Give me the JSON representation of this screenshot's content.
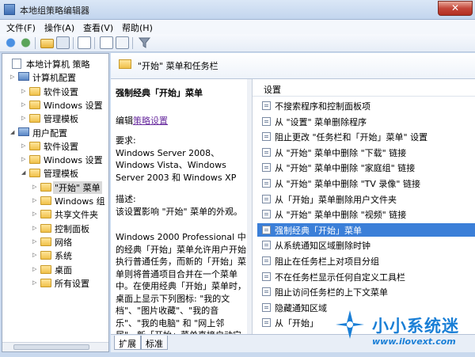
{
  "window": {
    "title": "本地组策略编辑器",
    "close_glyph": "✕"
  },
  "menubar": {
    "items": [
      "文件(F)",
      "操作(A)",
      "查看(V)",
      "帮助(H)"
    ]
  },
  "tree": {
    "nodes": [
      {
        "label": "本地计算机 策略",
        "level": 0,
        "icon": "doc"
      },
      {
        "label": "计算机配置",
        "level": 1,
        "icon": "monitor",
        "expanded": false
      },
      {
        "label": "软件设置",
        "level": 2,
        "icon": "folder"
      },
      {
        "label": "Windows 设置",
        "level": 2,
        "icon": "folder"
      },
      {
        "label": "管理模板",
        "level": 2,
        "icon": "folder"
      },
      {
        "label": "用户配置",
        "level": 1,
        "icon": "monitor",
        "expanded": true
      },
      {
        "label": "软件设置",
        "level": 2,
        "icon": "folder"
      },
      {
        "label": "Windows 设置",
        "level": 2,
        "icon": "folder"
      },
      {
        "label": "管理模板",
        "level": 2,
        "icon": "folder",
        "expanded": true
      },
      {
        "label": "\"开始\" 菜单",
        "level": 3,
        "icon": "folder",
        "selected": true
      },
      {
        "label": "Windows 组",
        "level": 3,
        "icon": "folder"
      },
      {
        "label": "共享文件夹",
        "level": 3,
        "icon": "folder"
      },
      {
        "label": "控制面板",
        "level": 3,
        "icon": "folder"
      },
      {
        "label": "网络",
        "level": 3,
        "icon": "folder"
      },
      {
        "label": "系统",
        "level": 3,
        "icon": "folder"
      },
      {
        "label": "桌面",
        "level": 3,
        "icon": "folder"
      },
      {
        "label": "所有设置",
        "level": 3,
        "icon": "folder"
      }
    ]
  },
  "right_header": {
    "title": "\"开始\" 菜单和任务栏"
  },
  "description": {
    "heading": "强制经典「开始」菜单",
    "edit_prefix": "编辑",
    "edit_link": "策略设置",
    "req_label": "要求:",
    "req_lines": [
      "Windows Server 2008、",
      "Windows Vista、Windows",
      "Server 2003 和 Windows XP"
    ],
    "desc_label": "描述:",
    "desc_lines": [
      "该设置影响 \"开始\" 菜单的外观。"
    ],
    "body_lines": [
      "Windows 2000 Professional 中",
      "的经典「开始」菜单允许用户开始",
      "执行普通任务，而新的「开始」菜",
      "单则将普通项目合并在一个菜单",
      "中。在使用经典「开始」菜单时，",
      "桌面上显示下列图标: \"我的文",
      "档\"、\"图片收藏\"、\"我的音",
      "乐\"、\"我的电脑\" 和 \"网上邻",
      "居\"。新「开始」菜单直接启动它"
    ]
  },
  "list": {
    "header": "设置",
    "rows": [
      {
        "text": "不搜索程序和控制面板项",
        "selected": false
      },
      {
        "text": "从 \"设置\" 菜单删除程序",
        "selected": false
      },
      {
        "text": "阻止更改 \"任务栏和「开始」菜单\" 设置",
        "selected": false
      },
      {
        "text": "从 \"开始\" 菜单中删除 \"下载\" 链接",
        "selected": false
      },
      {
        "text": "从 \"开始\" 菜单中删除 \"家庭组\" 链接",
        "selected": false
      },
      {
        "text": "从 \"开始\" 菜单中删除 \"TV 录像\" 链接",
        "selected": false
      },
      {
        "text": "从「开始」菜单删除用户文件夹",
        "selected": false
      },
      {
        "text": "从 \"开始\" 菜单中删除 \"视频\" 链接",
        "selected": false
      },
      {
        "text": "强制经典「开始」菜单",
        "selected": true
      },
      {
        "text": "从系统通知区域删除时钟",
        "selected": false
      },
      {
        "text": "阻止在任务栏上对项目分组",
        "selected": false
      },
      {
        "text": "不在任务栏显示任何自定义工具栏",
        "selected": false
      },
      {
        "text": "阻止访问任务栏的上下文菜单",
        "selected": false
      },
      {
        "text": "隐藏通知区域",
        "selected": false
      },
      {
        "text": "从「开始」",
        "selected": false
      }
    ]
  },
  "tabs": {
    "items": [
      "扩展",
      "标准"
    ],
    "active": 0
  },
  "watermark": {
    "text": "小小系统迷",
    "url": "www.ilovext.com"
  },
  "colors": {
    "selection": "#3b7fd8",
    "link": "#6b2fa0",
    "brand": "#1a7fd6"
  }
}
